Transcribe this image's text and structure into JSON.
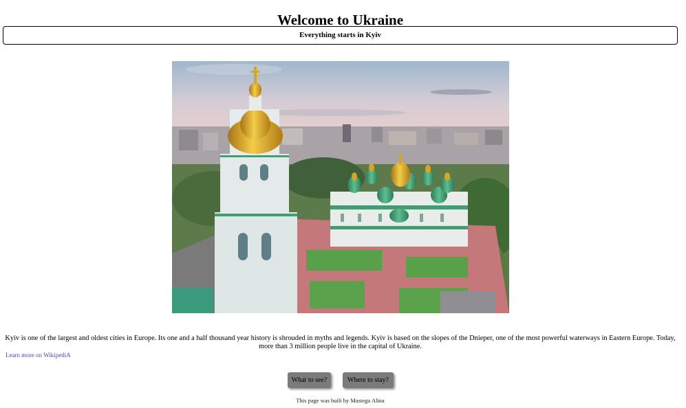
{
  "header": {
    "title": "Welcome to Ukraine",
    "subtitle": "Everything starts in Kyiv"
  },
  "hero": {
    "subject": "Saint Sophia Cathedral and bell tower, Kyiv"
  },
  "main": {
    "description": "Kyiv is one of the largest and oldest cities in Europe. Its one and a half thousand year history is shrouded in myths and legends. Kyiv is based on the slopes of the Dnieper, one of the most powerful waterways in Eastern Europe. Today, more than 3 million people live in the capital of Ukraine.",
    "wiki_link": "Learn more on WikipediA"
  },
  "buttons": {
    "see": "What to see?",
    "stay": "Where to stay?"
  },
  "footer": {
    "credit": "This page was built by Mastega Alina"
  },
  "colors": {
    "button_bg": "#7b7b7b",
    "link": "#5a3fd6",
    "dome_gold": "#d8a422",
    "dome_green": "#3f9e72"
  }
}
